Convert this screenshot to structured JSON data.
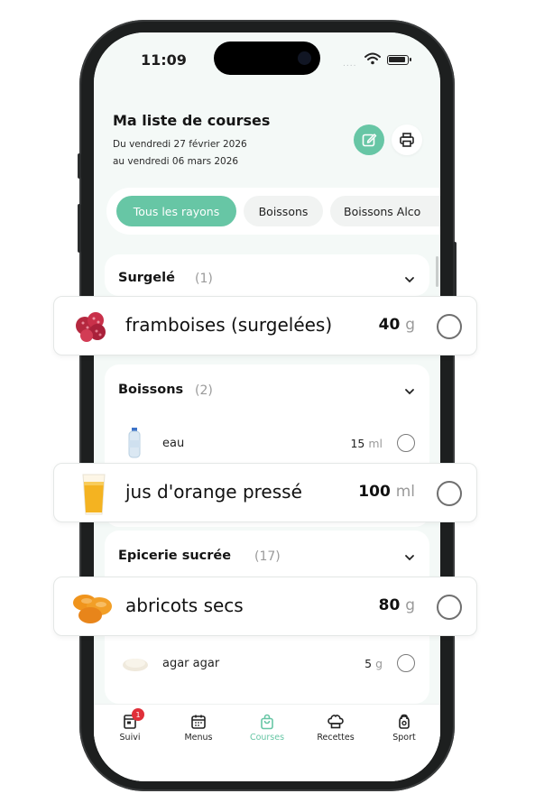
{
  "status_bar": {
    "time": "11:09",
    "signal": "....",
    "icons": [
      "wifi-icon",
      "battery-icon"
    ]
  },
  "header": {
    "title": "Ma liste de courses",
    "date_from": "Du vendredi 27 février 2026",
    "date_to": "au vendredi 06 mars 2026",
    "edit_icon": "edit-icon",
    "print_icon": "printer-icon"
  },
  "filters": [
    "Tous les rayons",
    "Boissons",
    "Boissons Alco"
  ],
  "sections": [
    {
      "title": "Surgelé",
      "count": "(1)",
      "items": [
        {
          "name": "framboises (surgelées)",
          "qty": "40",
          "unit": "g"
        }
      ]
    },
    {
      "title": "Boissons",
      "count": "(2)",
      "items": [
        {
          "name": "eau",
          "qty": "15",
          "unit": "ml"
        },
        {
          "name": "jus d'orange pressé",
          "qty": "100",
          "unit": "ml"
        }
      ]
    },
    {
      "title": "Epicerie sucrée",
      "count": "(17)",
      "items": [
        {
          "name": "abricots secs",
          "qty": "80",
          "unit": "g"
        },
        {
          "name": "agar agar",
          "qty": "5",
          "unit": "g"
        }
      ]
    }
  ],
  "tabbar": {
    "tabs": [
      {
        "label": "Suivi",
        "icon": "journal-icon",
        "badge": "1"
      },
      {
        "label": "Menus",
        "icon": "calendar-icon"
      },
      {
        "label": "Courses",
        "icon": "shopping-bag-icon",
        "active": true
      },
      {
        "label": "Recettes",
        "icon": "chef-hat-icon"
      },
      {
        "label": "Sport",
        "icon": "kettlebell-icon"
      }
    ]
  },
  "colors": {
    "accent": "#67c6a5",
    "badge": "#e0303a",
    "screen_bg": "#f4f9f7"
  }
}
